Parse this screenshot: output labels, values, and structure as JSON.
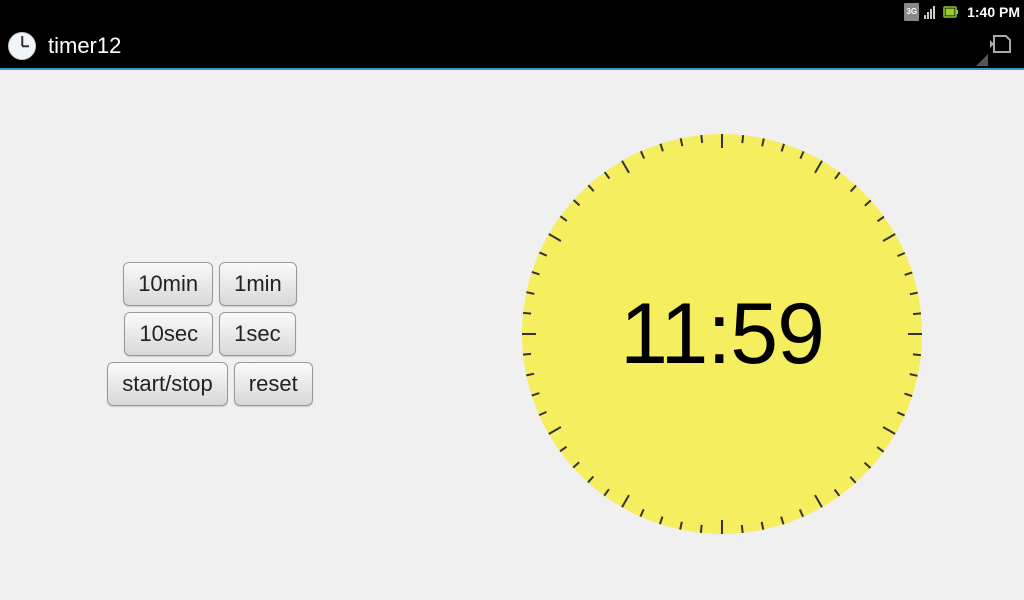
{
  "status_bar": {
    "network_label": "3G",
    "time": "1:40 PM"
  },
  "title_bar": {
    "app_title": "timer12"
  },
  "controls": {
    "row1": {
      "btn1": "10min",
      "btn2": "1min"
    },
    "row2": {
      "btn1": "10sec",
      "btn2": "1sec"
    },
    "row3": {
      "btn1": "start/stop",
      "btn2": "reset"
    }
  },
  "clock": {
    "display_time": "11:59"
  }
}
